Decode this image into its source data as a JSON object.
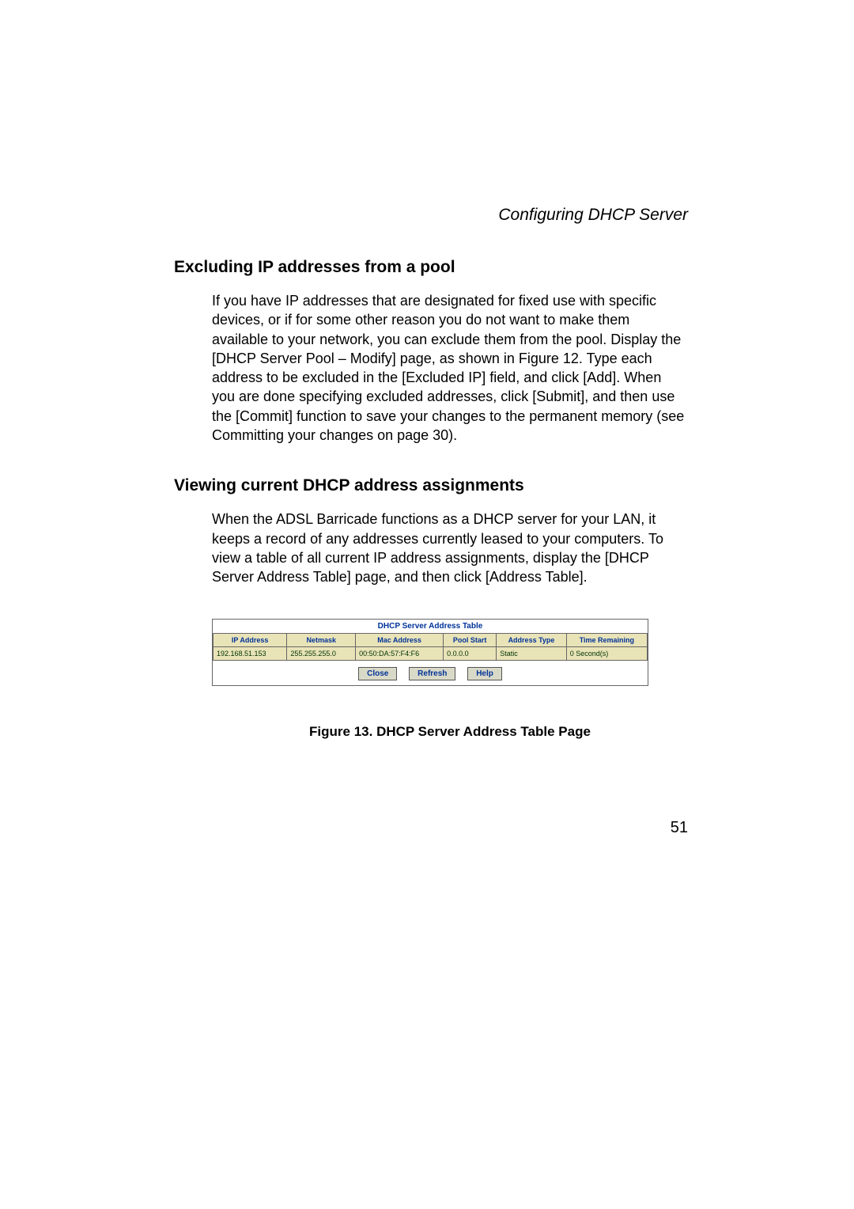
{
  "running_head": "Configuring DHCP Server",
  "section1": {
    "heading": "Excluding IP addresses from a pool",
    "body": "If you have IP addresses that are designated for fixed use with specific devices, or if for some other reason you do not want to make them available to your network, you can exclude them from the pool. Display the [DHCP Server Pool – Modify] page, as shown in Figure 12. Type each address to be excluded in the [Excluded IP] field, and click [Add]. When you are done specifying excluded addresses, click [Submit], and then use the [Commit] function to save your changes to the permanent memory (see Committing your changes on page 30)."
  },
  "section2": {
    "heading": "Viewing current DHCP address assignments",
    "body": "When the ADSL Barricade functions as a DHCP server for your LAN, it keeps a record of any addresses currently leased to your computers. To view a table of all current IP address assignments, display the [DHCP Server Address Table] page, and then click [Address Table]."
  },
  "figure": {
    "title": "DHCP Server Address Table",
    "headers": {
      "ip": "IP Address",
      "netmask": "Netmask",
      "mac": "Mac Address",
      "pool": "Pool Start",
      "type": "Address Type",
      "time": "Time Remaining"
    },
    "row": {
      "ip": "192.168.51.153",
      "netmask": "255.255.255.0",
      "mac": "00:50:DA:57:F4:F6",
      "pool": "0.0.0.0",
      "type": "Static",
      "time": "0 Second(s)"
    },
    "buttons": {
      "close": "Close",
      "refresh": "Refresh",
      "help": "Help"
    },
    "caption": "Figure 13.  DHCP Server Address Table Page"
  },
  "page_number": "51"
}
